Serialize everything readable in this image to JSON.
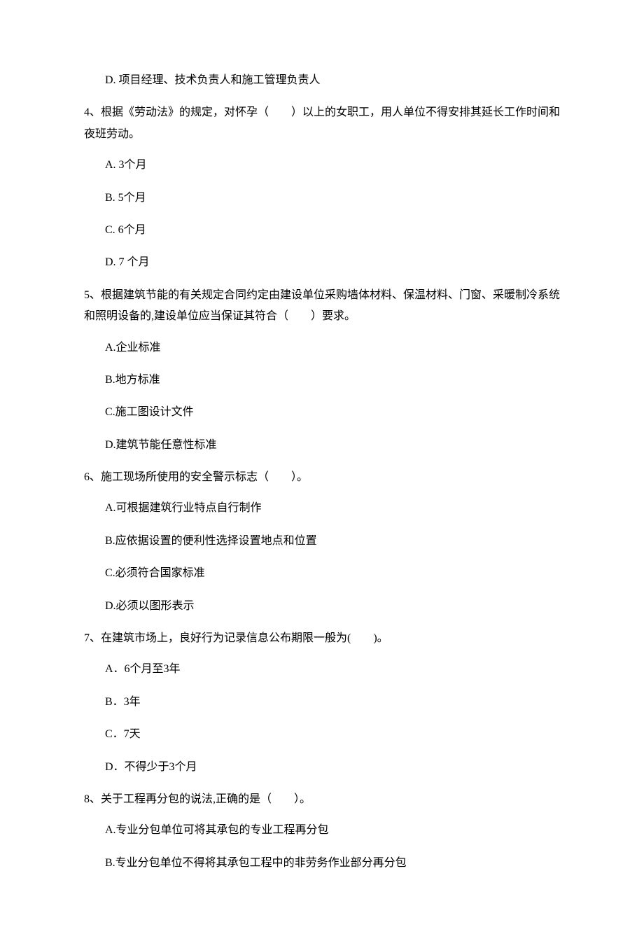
{
  "items": [
    {
      "type": "option",
      "text": "D. 项目经理、技术负责人和施工管理负责人"
    },
    {
      "type": "question",
      "text": "4、根据《劳动法》的规定，对怀孕（　　）以上的女职工，用人单位不得安排其延长工作时间和夜班劳动。"
    },
    {
      "type": "option",
      "text": "A. 3个月"
    },
    {
      "type": "option",
      "text": "B. 5个月"
    },
    {
      "type": "option",
      "text": "C. 6个月"
    },
    {
      "type": "option",
      "text": "D. 7 个月"
    },
    {
      "type": "question",
      "text": "5、根据建筑节能的有关规定合同约定由建设单位采购墙体材料、保温材料、门窗、采暖制冷系统和照明设备的,建设单位应当保证其符合（　　）要求。"
    },
    {
      "type": "option",
      "text": "A.企业标准"
    },
    {
      "type": "option",
      "text": "B.地方标准"
    },
    {
      "type": "option",
      "text": "C.施工图设计文件"
    },
    {
      "type": "option",
      "text": "D.建筑节能任意性标准"
    },
    {
      "type": "question",
      "text": "6、施工现场所使用的安全警示标志（　　）。"
    },
    {
      "type": "option",
      "text": "A.可根据建筑行业特点自行制作"
    },
    {
      "type": "option",
      "text": "B.应依据设置的便利性选择设置地点和位置"
    },
    {
      "type": "option",
      "text": "C.必须符合国家标准"
    },
    {
      "type": "option",
      "text": "D.必须以图形表示"
    },
    {
      "type": "question",
      "text": "7、在建筑市场上，良好行为记录信息公布期限一般为(　　)。"
    },
    {
      "type": "option",
      "text": "A．6个月至3年"
    },
    {
      "type": "option",
      "text": "B．3年"
    },
    {
      "type": "option",
      "text": "C．7天"
    },
    {
      "type": "option",
      "text": "D．不得少于3个月"
    },
    {
      "type": "question",
      "text": "8、关于工程再分包的说法,正确的是（　　）。"
    },
    {
      "type": "option",
      "text": "A.专业分包单位可将其承包的专业工程再分包"
    },
    {
      "type": "option",
      "text": "B.专业分包单位不得将其承包工程中的非劳务作业部分再分包"
    }
  ]
}
